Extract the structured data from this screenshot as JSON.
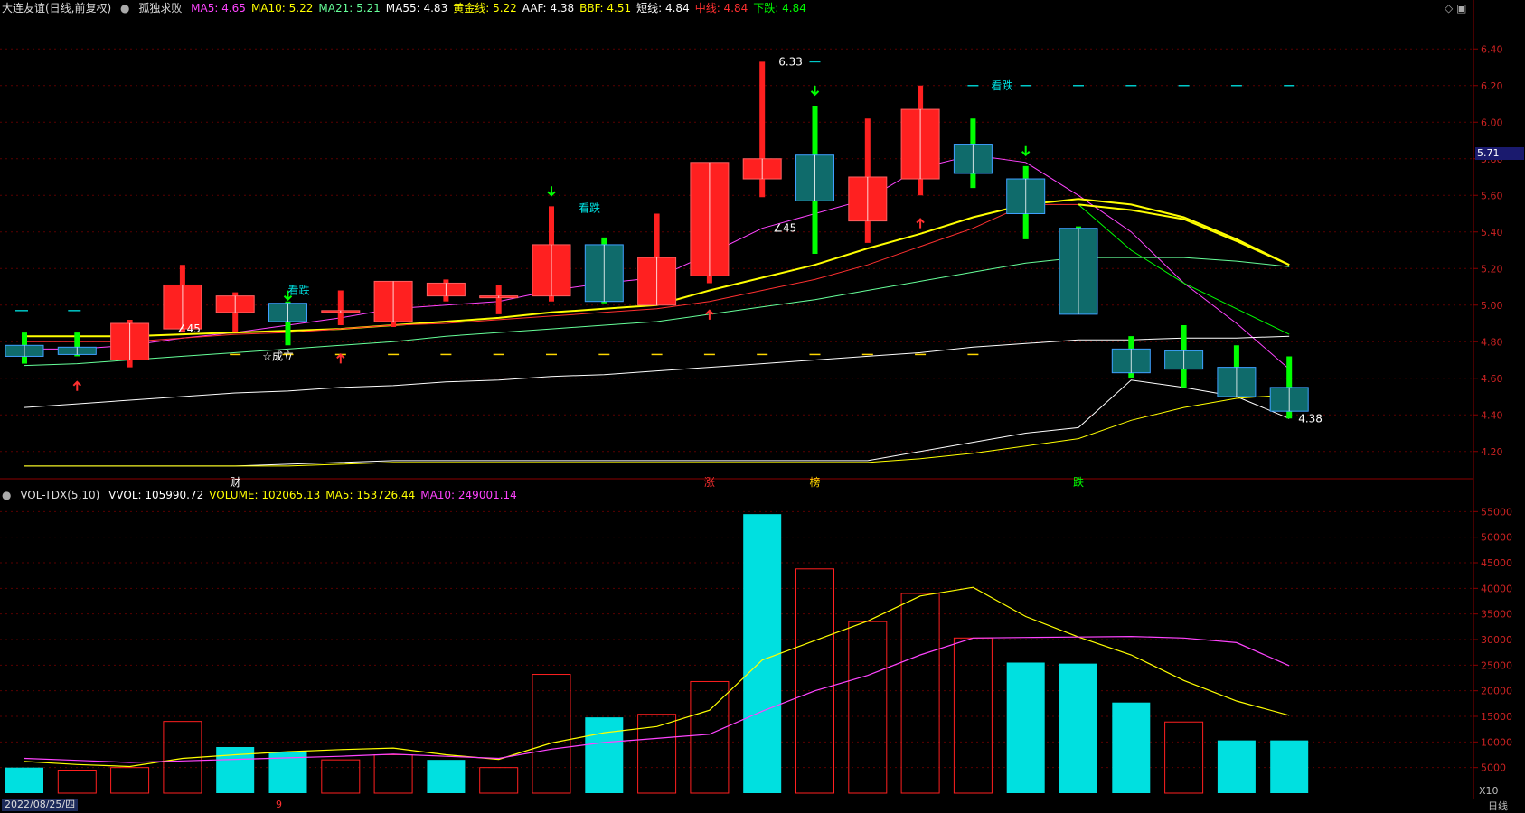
{
  "header": {
    "title": "大连友谊(日线,前复权)",
    "indicator_name": "孤独求败",
    "ma_items": [
      {
        "label": "MA5: 4.65",
        "color": "#ff44ff"
      },
      {
        "label": "MA10: 5.22",
        "color": "#ffff00"
      },
      {
        "label": "MA21: 5.21",
        "color": "#66ff99"
      },
      {
        "label": "MA55: 4.83",
        "color": "#ffffff"
      },
      {
        "label": "黄金线: 5.22",
        "color": "#ffff00"
      },
      {
        "label": "AAF: 4.38",
        "color": "#ffffff"
      },
      {
        "label": "BBF: 4.51",
        "color": "#ffff00"
      },
      {
        "label": "短线: 4.84",
        "color": "#ffffff"
      },
      {
        "label": "中线: 4.84",
        "color": "#ff3030"
      },
      {
        "label": "下跌: 4.84",
        "color": "#00ff00"
      }
    ]
  },
  "vol_header": {
    "name": "VOL-TDX(5,10)",
    "items": [
      {
        "label": "VVOL: 105990.72",
        "color": "#ffffff"
      },
      {
        "label": "VOLUME: 102065.13",
        "color": "#ffff00"
      },
      {
        "label": "MA5: 153726.44",
        "color": "#ffff00"
      },
      {
        "label": "MA10: 249001.14",
        "color": "#ff44ff"
      }
    ]
  },
  "last_price_tag": "5.71",
  "period_label": "日线",
  "x10_label": "X10",
  "date_label": "2022/08/25/四",
  "bottom_marker": "9",
  "colors": {
    "up": "#ff2020",
    "down": "#00e0e0",
    "down_body": "#0f6b6b",
    "grid": "#5a0000",
    "axis_text": "#cc2222"
  },
  "chart_data": [
    {
      "type": "candlestick",
      "ylim": [
        4.1,
        6.5
      ],
      "yticks": [
        "6.40",
        "6.20",
        "6.00",
        "5.80",
        "5.60",
        "5.40",
        "5.20",
        "5.00",
        "4.80",
        "4.60",
        "4.40",
        "4.20"
      ],
      "candles": [
        {
          "o": 4.78,
          "h": 4.85,
          "l": 4.68,
          "c": 4.72,
          "up": false
        },
        {
          "o": 4.77,
          "h": 4.85,
          "l": 4.72,
          "c": 4.73,
          "up": false
        },
        {
          "o": 4.7,
          "h": 4.92,
          "l": 4.66,
          "c": 4.9,
          "up": true
        },
        {
          "o": 4.87,
          "h": 5.22,
          "l": 4.85,
          "c": 5.11,
          "up": true
        },
        {
          "o": 4.96,
          "h": 5.07,
          "l": 4.85,
          "c": 5.05,
          "up": true
        },
        {
          "o": 5.01,
          "h": 5.02,
          "l": 4.78,
          "c": 4.91,
          "up": false
        },
        {
          "o": 4.96,
          "h": 5.08,
          "l": 4.89,
          "c": 4.97,
          "up": true
        },
        {
          "o": 4.91,
          "h": 5.12,
          "l": 4.88,
          "c": 5.13,
          "up": true
        },
        {
          "o": 5.05,
          "h": 5.14,
          "l": 5.02,
          "c": 5.12,
          "up": true
        },
        {
          "o": 5.04,
          "h": 5.11,
          "l": 4.95,
          "c": 5.05,
          "up": true
        },
        {
          "o": 5.05,
          "h": 5.54,
          "l": 5.02,
          "c": 5.33,
          "up": true
        },
        {
          "o": 5.33,
          "h": 5.37,
          "l": 5.01,
          "c": 5.02,
          "up": false
        },
        {
          "o": 5.0,
          "h": 5.5,
          "l": 5.0,
          "c": 5.26,
          "up": true
        },
        {
          "o": 5.16,
          "h": 5.78,
          "l": 5.12,
          "c": 5.78,
          "up": true
        },
        {
          "o": 5.69,
          "h": 6.33,
          "l": 5.59,
          "c": 5.8,
          "up": true
        },
        {
          "o": 5.82,
          "h": 6.09,
          "l": 5.28,
          "c": 5.57,
          "up": false
        },
        {
          "o": 5.46,
          "h": 6.02,
          "l": 5.34,
          "c": 5.7,
          "up": true
        },
        {
          "o": 5.69,
          "h": 6.2,
          "l": 5.6,
          "c": 6.07,
          "up": true
        },
        {
          "o": 5.88,
          "h": 6.02,
          "l": 5.64,
          "c": 5.72,
          "up": false
        },
        {
          "o": 5.69,
          "h": 5.76,
          "l": 5.36,
          "c": 5.5,
          "up": false
        },
        {
          "o": 5.42,
          "h": 5.43,
          "l": 4.95,
          "c": 4.95,
          "up": false
        },
        {
          "o": 4.76,
          "h": 4.83,
          "l": 4.6,
          "c": 4.63,
          "up": false
        },
        {
          "o": 4.75,
          "h": 4.89,
          "l": 4.55,
          "c": 4.65,
          "up": false
        },
        {
          "o": 4.66,
          "h": 4.78,
          "l": 4.5,
          "c": 4.5,
          "up": false
        },
        {
          "o": 4.55,
          "h": 4.72,
          "l": 4.38,
          "c": 4.42,
          "up": false
        }
      ],
      "lines": [
        {
          "name": "MA5",
          "color": "#ff44ff",
          "values": [
            4.76,
            4.76,
            4.78,
            4.82,
            4.85,
            4.89,
            4.93,
            4.98,
            5.0,
            5.02,
            5.08,
            5.12,
            5.15,
            5.28,
            5.42,
            5.5,
            5.58,
            5.75,
            5.82,
            5.78,
            5.6,
            5.4,
            5.12,
            4.9,
            4.65
          ]
        },
        {
          "name": "MA10",
          "color": "#ffff00",
          "values": [
            4.83,
            4.83,
            4.83,
            4.84,
            4.85,
            4.86,
            4.87,
            4.89,
            4.91,
            4.93,
            4.96,
            4.98,
            5.0,
            5.08,
            5.15,
            5.22,
            5.31,
            5.39,
            5.48,
            5.55,
            5.58,
            5.55,
            5.48,
            5.36,
            5.22
          ]
        },
        {
          "name": "MA21",
          "color": "#66ff99",
          "values": [
            4.67,
            4.68,
            4.7,
            4.72,
            4.74,
            4.76,
            4.78,
            4.8,
            4.83,
            4.85,
            4.87,
            4.89,
            4.91,
            4.95,
            4.99,
            5.03,
            5.08,
            5.13,
            5.18,
            5.23,
            5.26,
            5.26,
            5.26,
            5.24,
            5.21
          ]
        },
        {
          "name": "MA55",
          "color": "#ffffff",
          "values": [
            4.44,
            4.46,
            4.48,
            4.5,
            4.52,
            4.53,
            4.55,
            4.56,
            4.58,
            4.59,
            4.61,
            4.62,
            4.64,
            4.66,
            4.68,
            4.7,
            4.72,
            4.74,
            4.77,
            4.79,
            4.81,
            4.81,
            4.82,
            4.82,
            4.83
          ]
        },
        {
          "name": "中线",
          "color": "#ff3030",
          "values": [
            4.8,
            4.8,
            4.8,
            4.82,
            4.84,
            4.85,
            4.87,
            4.89,
            4.9,
            4.92,
            4.94,
            4.96,
            4.98,
            5.02,
            5.08,
            5.14,
            5.22,
            5.32,
            5.42,
            5.55,
            5.55,
            null,
            null,
            null,
            null
          ]
        },
        {
          "name": "下跌",
          "color": "#00ff00",
          "values": [
            null,
            null,
            null,
            null,
            null,
            null,
            null,
            null,
            null,
            null,
            null,
            null,
            null,
            null,
            null,
            null,
            null,
            null,
            null,
            null,
            5.55,
            5.3,
            5.12,
            4.98,
            4.84
          ]
        },
        {
          "name": "AAF",
          "color": "#ffffff",
          "values": [
            4.12,
            4.12,
            4.12,
            4.12,
            4.12,
            4.13,
            4.14,
            4.15,
            4.15,
            4.15,
            4.15,
            4.15,
            4.15,
            4.15,
            4.15,
            4.15,
            4.15,
            4.2,
            4.25,
            4.3,
            4.33,
            4.59,
            4.55,
            4.5,
            4.38
          ]
        },
        {
          "name": "BBF",
          "color": "#ffff00",
          "values": [
            4.12,
            4.12,
            4.12,
            4.12,
            4.12,
            4.12,
            4.13,
            4.14,
            4.14,
            4.14,
            4.14,
            4.14,
            4.14,
            4.14,
            4.14,
            4.14,
            4.14,
            4.16,
            4.19,
            4.23,
            4.27,
            4.37,
            4.44,
            4.49,
            4.51
          ]
        },
        {
          "name": "黄金线",
          "color": "#ffff00",
          "values": [
            null,
            null,
            null,
            null,
            null,
            null,
            null,
            null,
            null,
            null,
            null,
            null,
            null,
            null,
            null,
            null,
            null,
            null,
            null,
            null,
            5.55,
            5.52,
            5.47,
            5.35,
            5.22
          ]
        }
      ],
      "annotations": {
        "high_label": "6.33",
        "low_label": "4.38",
        "mid_label": "∠45",
        "mid_label2": "∠45",
        "kandie": "看跌",
        "chengli": "☆成立",
        "bottom_chars": [
          "财",
          "涨",
          "榜",
          "跌"
        ]
      }
    },
    {
      "type": "bar",
      "ylim": [
        0,
        57000
      ],
      "yticks": [
        "55000",
        "50000",
        "45000",
        "40000",
        "35000",
        "30000",
        "25000",
        "20000",
        "15000",
        "10000",
        "5000"
      ],
      "values": [
        5000,
        4500,
        5000,
        14000,
        9000,
        8000,
        6500,
        7500,
        6500,
        5000,
        23200,
        14800,
        15400,
        21800,
        54500,
        43800,
        33500,
        39000,
        30300,
        25500,
        25300,
        17700,
        13900,
        10300,
        10300
      ],
      "up": [
        false,
        true,
        true,
        true,
        false,
        false,
        true,
        true,
        false,
        true,
        true,
        false,
        true,
        true,
        false,
        true,
        true,
        true,
        true,
        false,
        false,
        false,
        true,
        false,
        false
      ],
      "ma5": [
        6200,
        5600,
        5200,
        6800,
        7500,
        8100,
        8500,
        8800,
        7500,
        6600,
        9800,
        11800,
        13000,
        16200,
        26000,
        29800,
        33600,
        38500,
        40200,
        34500,
        30500,
        27000,
        22000,
        18000,
        15200
      ],
      "ma10": [
        6800,
        6400,
        6000,
        6300,
        6600,
        6900,
        7200,
        7600,
        7200,
        6800,
        8600,
        9900,
        10700,
        11500,
        16000,
        20000,
        23000,
        27000,
        30300,
        30400,
        30500,
        30600,
        30300,
        29400,
        24900
      ]
    }
  ]
}
